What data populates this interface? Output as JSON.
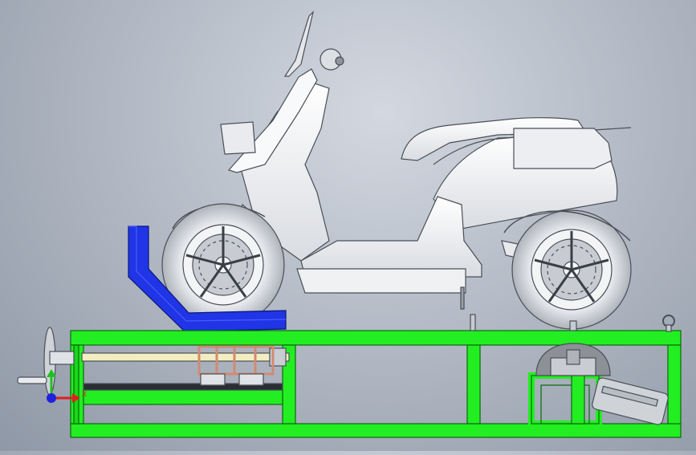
{
  "viewport": {
    "background_top": "#d3d8e0",
    "background_bottom": "#8f98a6"
  },
  "model": {
    "scooter_body_color": "#f4f5f7",
    "scooter_edge_color": "#4a4f57",
    "frame_color": "#22ee22",
    "frame_edge_color": "#0a6a0a",
    "wheel_chock_color": "#1f35e6",
    "rail_color": "#f2eec0",
    "clamp_color": "#e9b6a0",
    "motor_color": "#cfd3d8"
  },
  "triad": {
    "x_label": "X",
    "x_color": "#e02020",
    "y_color": "#20c020",
    "z_color": "#2020e0"
  }
}
